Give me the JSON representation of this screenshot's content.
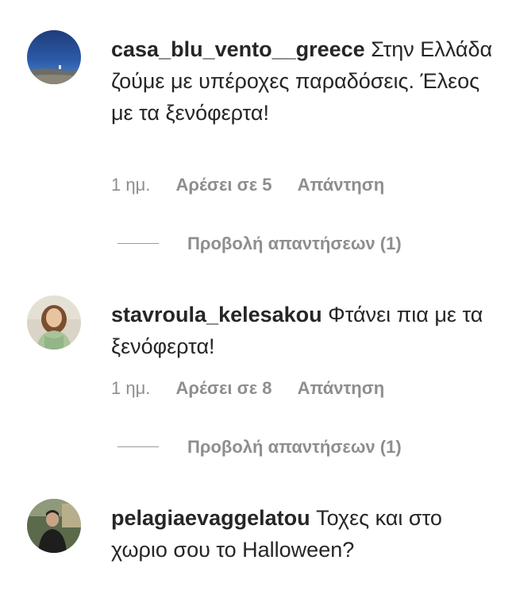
{
  "comments": [
    {
      "username": "casa_blu_vento__greece",
      "text": " Στην Ελλάδα ζούμε με υπέροχες παραδόσεις. Έλεος με τα ξενόφερτα!",
      "time": "1 ημ.",
      "likes": "Αρέσει σε 5",
      "reply": "Απάντηση",
      "view_replies": "Προβολή απαντήσεων (1)",
      "avatar_icon": "sea-landscape-avatar"
    },
    {
      "username": "stavroula_kelesakou",
      "text": " Φτάνει πια με τα ξενόφερτα!",
      "time": "1 ημ.",
      "likes": "Αρέσει σε 8",
      "reply": "Απάντηση",
      "view_replies": "Προβολή απαντήσεων (1)",
      "avatar_icon": "woman-portrait-avatar"
    },
    {
      "username": "pelagiaevaggelatou",
      "text": " Τοχες και στο χωριο σου το Halloween?",
      "avatar_icon": "person-photo-avatar"
    }
  ]
}
